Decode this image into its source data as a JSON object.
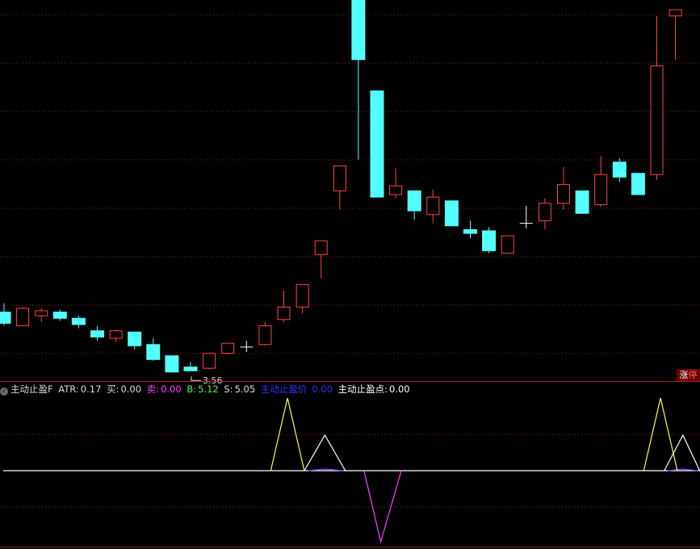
{
  "indicator": {
    "name": "主动止盈F",
    "atr_label": "ATR:",
    "atr_value": "0.17",
    "buy_label": "买:",
    "buy_value": "0.00",
    "sell_label": "卖:",
    "sell_value": "0.00",
    "b_label": "B:",
    "b_value": "5.12",
    "s_label": "S:",
    "s_value": "5.05",
    "tp_price_label": "主动止盈价",
    "tp_price_value": "0.00",
    "tp_point_label": "主动止盈点:",
    "tp_point_value": "0.00"
  },
  "badge": {
    "part1": "涨",
    "part2": "停"
  },
  "colors": {
    "up": "#ff4444",
    "down": "#54ffff",
    "flat": "#ffffff",
    "grid": "#a01a1a",
    "divider": "#b0201e",
    "ind_main": "#ffffff",
    "ind_b": "#ffff40",
    "ind_s": "#ffffff",
    "ind_sell": "#ff40ff",
    "ind_purple": "#9040ff",
    "atr_text": "#d8d8d8",
    "sell_text": "#ff40ff",
    "b_text": "#40ff40",
    "tp_price_text": "#3030ff",
    "tp_point_text": "#ffffff"
  },
  "chart_data": {
    "type": "candlestick",
    "price_range": [
      3.4,
      6.45
    ],
    "low_annotation": {
      "text": "3.56",
      "candle_index": 10
    },
    "candles": [
      {
        "o": 4.03,
        "h": 4.1,
        "l": 3.92,
        "c": 3.94
      },
      {
        "o": 3.92,
        "h": 4.07,
        "l": 3.92,
        "c": 4.06
      },
      {
        "o": 4.0,
        "h": 4.06,
        "l": 3.95,
        "c": 4.04
      },
      {
        "o": 4.03,
        "h": 4.05,
        "l": 3.96,
        "c": 3.98
      },
      {
        "o": 3.98,
        "h": 4.0,
        "l": 3.9,
        "c": 3.93
      },
      {
        "o": 3.88,
        "h": 3.92,
        "l": 3.8,
        "c": 3.83
      },
      {
        "o": 3.82,
        "h": 3.89,
        "l": 3.79,
        "c": 3.88
      },
      {
        "o": 3.87,
        "h": 3.87,
        "l": 3.73,
        "c": 3.76
      },
      {
        "o": 3.77,
        "h": 3.82,
        "l": 3.64,
        "c": 3.65
      },
      {
        "o": 3.68,
        "h": 3.68,
        "l": 3.55,
        "c": 3.55
      },
      {
        "o": 3.59,
        "h": 3.63,
        "l": 3.56,
        "c": 3.56
      },
      {
        "o": 3.58,
        "h": 3.7,
        "l": 3.57,
        "c": 3.7
      },
      {
        "o": 3.7,
        "h": 3.78,
        "l": 3.69,
        "c": 3.78
      },
      {
        "o": 3.75,
        "h": 3.8,
        "l": 3.71,
        "c": 3.75
      },
      {
        "o": 3.77,
        "h": 3.95,
        "l": 3.76,
        "c": 3.92
      },
      {
        "o": 3.97,
        "h": 4.2,
        "l": 3.95,
        "c": 4.07
      },
      {
        "o": 4.07,
        "h": 4.22,
        "l": 4.02,
        "c": 4.25
      },
      {
        "o": 4.49,
        "h": 4.6,
        "l": 4.3,
        "c": 4.6
      },
      {
        "o": 5.0,
        "h": 5.2,
        "l": 4.85,
        "c": 5.2
      },
      {
        "o": 6.55,
        "h": 6.55,
        "l": 5.25,
        "c": 6.05
      },
      {
        "o": 5.8,
        "h": 5.8,
        "l": 4.95,
        "c": 4.95
      },
      {
        "o": 4.97,
        "h": 5.18,
        "l": 4.94,
        "c": 5.04
      },
      {
        "o": 5.0,
        "h": 5.0,
        "l": 4.77,
        "c": 4.84
      },
      {
        "o": 4.81,
        "h": 5.01,
        "l": 4.74,
        "c": 4.95
      },
      {
        "o": 4.92,
        "h": 4.92,
        "l": 4.72,
        "c": 4.72
      },
      {
        "o": 4.69,
        "h": 4.76,
        "l": 4.62,
        "c": 4.66
      },
      {
        "o": 4.68,
        "h": 4.71,
        "l": 4.5,
        "c": 4.52
      },
      {
        "o": 4.5,
        "h": 4.64,
        "l": 4.5,
        "c": 4.64
      },
      {
        "o": 4.74,
        "h": 4.88,
        "l": 4.7,
        "c": 4.74
      },
      {
        "o": 4.76,
        "h": 4.94,
        "l": 4.69,
        "c": 4.9
      },
      {
        "o": 4.9,
        "h": 5.19,
        "l": 4.85,
        "c": 5.05
      },
      {
        "o": 5.0,
        "h": 5.0,
        "l": 4.84,
        "c": 4.82
      },
      {
        "o": 4.89,
        "h": 5.28,
        "l": 4.87,
        "c": 5.13
      },
      {
        "o": 5.23,
        "h": 5.26,
        "l": 5.07,
        "c": 5.11
      },
      {
        "o": 5.14,
        "h": 5.14,
        "l": 4.97,
        "c": 4.97
      },
      {
        "o": 5.13,
        "h": 6.4,
        "l": 5.09,
        "c": 6.0
      },
      {
        "o": 6.4,
        "h": 6.45,
        "l": 6.05,
        "c": 6.45
      }
    ],
    "indicator_series": {
      "range": [
        -1.0,
        1.0
      ],
      "B": [
        {
          "i": 14.3,
          "v": 0
        },
        {
          "i": 15.2,
          "v": 0.9
        },
        {
          "i": 16.1,
          "v": 0
        },
        {
          "i": 34.3,
          "v": 0
        },
        {
          "i": 35.2,
          "v": 0.9
        },
        {
          "i": 36.1,
          "v": 0
        }
      ],
      "S": [
        {
          "i": 16.1,
          "v": 0
        },
        {
          "i": 17.2,
          "v": 0.44
        },
        {
          "i": 18.3,
          "v": 0
        },
        {
          "i": 35.4,
          "v": 0
        },
        {
          "i": 36.4,
          "v": 0.44
        },
        {
          "i": 37.3,
          "v": 0
        }
      ],
      "sell": [
        {
          "i": 19.3,
          "v": 0
        },
        {
          "i": 20.2,
          "v": -0.88
        },
        {
          "i": 21.3,
          "v": 0
        }
      ],
      "purple": [
        {
          "i": 16.3,
          "v": 0
        },
        {
          "i": 17.2,
          "v": 0.02
        },
        {
          "i": 18.2,
          "v": 0
        },
        {
          "i": 35.6,
          "v": 0
        },
        {
          "i": 36.4,
          "v": 0.02
        },
        {
          "i": 37.2,
          "v": 0
        }
      ],
      "baseline": 0
    }
  }
}
